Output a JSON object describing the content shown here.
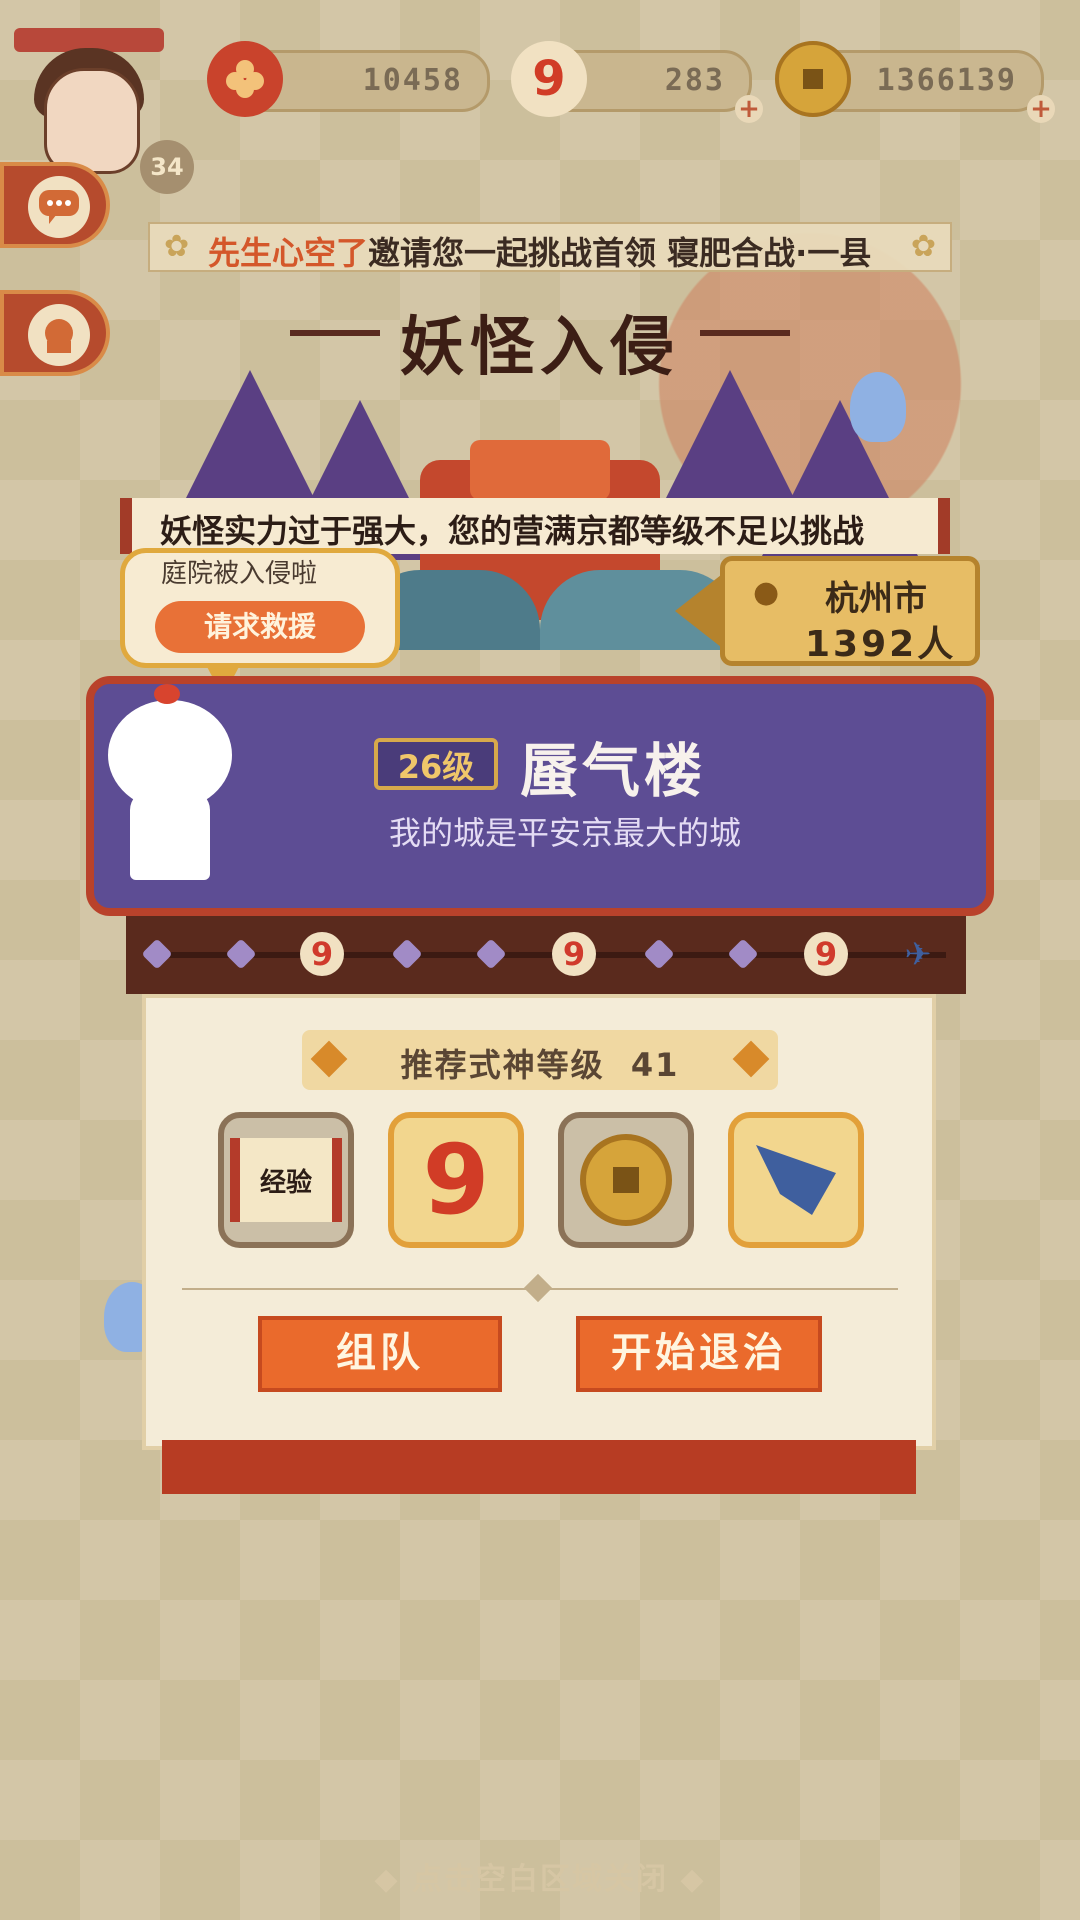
{
  "resources": [
    {
      "icon": "flower-token-icon",
      "value": "10458"
    },
    {
      "icon": "nine-badge-icon",
      "value": "283"
    },
    {
      "icon": "coin-icon",
      "value": "1366139"
    }
  ],
  "player": {
    "level": "34"
  },
  "broadcast": {
    "name": "先生心空了",
    "message": "邀请您一起挑战首领 寝肥合战·一县"
  },
  "title": "妖怪入侵",
  "warning": "妖怪实力过于强大，您的营满京都等级不足以挑战",
  "help_bubble": {
    "subtitle": "庭院被入侵啦",
    "button": "请求救援"
  },
  "location": {
    "city": "杭州市",
    "count": "1392人"
  },
  "castle": {
    "level_badge": "26级",
    "name": "蜃气楼",
    "description": "我的城是平安京最大的城"
  },
  "recommend": {
    "label": "推荐式神等级",
    "level": "41"
  },
  "rewards": [
    {
      "name": "exp-scroll",
      "label": "经验"
    },
    {
      "name": "nine-fragment",
      "label": "9"
    },
    {
      "name": "gold-coin",
      "label": ""
    },
    {
      "name": "paper-bird",
      "label": ""
    }
  ],
  "buttons": {
    "team": "组队",
    "start": "开始退治"
  },
  "close_hint": "◆ 点击空白区域关闭 ◆",
  "colors": {
    "accent": "#ea6a2c",
    "panel": "#5d4d94",
    "frame": "#b9422b"
  }
}
